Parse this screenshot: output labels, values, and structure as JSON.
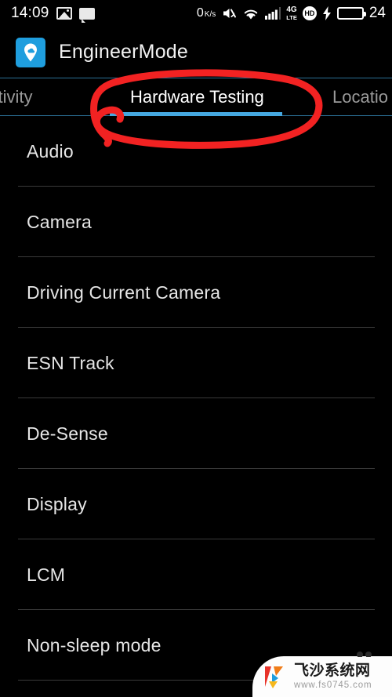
{
  "status_bar": {
    "time": "14:09",
    "icons_left": [
      "image-icon",
      "chat-icon"
    ],
    "net_speed_value": "0",
    "net_speed_unit_top": "K",
    "net_speed_unit_bottom": "s",
    "icons_right": [
      "mute-icon",
      "wifi-icon",
      "signal-bars-icon",
      "4g-lte-icon",
      "hd-icon",
      "charging-bolt-icon"
    ],
    "signal_label_top": "4G",
    "signal_label_bottom": "LTE",
    "hd_label": "HD",
    "battery_percent": "24",
    "battery_fill_color": "#1fd41f"
  },
  "app_bar": {
    "icon_name": "engineermode-app-icon",
    "icon_color": "#1f9ede",
    "title": "EngineerMode"
  },
  "tabs": {
    "accent_color": "#45a8e0",
    "items": [
      {
        "label": "nectivity",
        "full_label": "Connectivity",
        "active": false
      },
      {
        "label": "Hardware Testing",
        "full_label": "Hardware Testing",
        "active": true
      },
      {
        "label": "Locatio",
        "full_label": "Location",
        "active": false
      }
    ]
  },
  "list": {
    "items": [
      {
        "label": "Audio"
      },
      {
        "label": "Camera"
      },
      {
        "label": "Driving Current Camera"
      },
      {
        "label": "ESN Track"
      },
      {
        "label": "De-Sense"
      },
      {
        "label": "Display"
      },
      {
        "label": "LCM"
      },
      {
        "label": "Non-sleep mode"
      }
    ]
  },
  "annotation": {
    "type": "hand-drawn-ellipse",
    "color": "#f22222",
    "targets": "Hardware Testing"
  },
  "watermark": {
    "site_name": "飞沙系统网",
    "url": "www.fs0745.com",
    "logo_colors": [
      "#e8332a",
      "#f07c18",
      "#1f9ede",
      "#f6b81c"
    ]
  }
}
